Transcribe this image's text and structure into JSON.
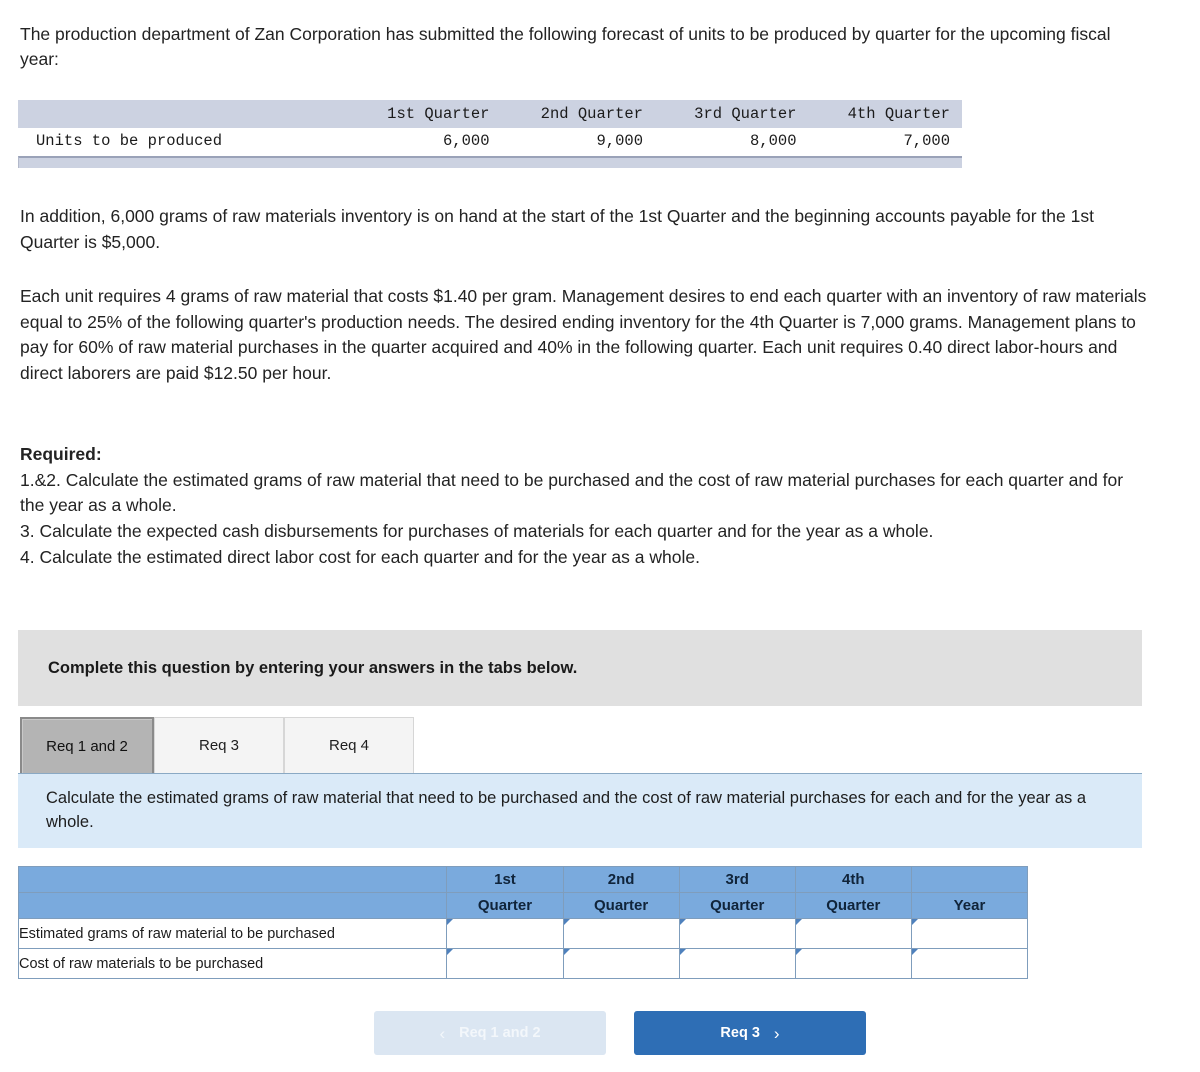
{
  "stem": {
    "text": "The production department of Zan Corporation has submitted the following forecast of units to be produced by quarter for the upcoming fiscal year:"
  },
  "given_table": {
    "headers": [
      "",
      "1st Quarter",
      "2nd Quarter",
      "3rd Quarter",
      "4th Quarter"
    ],
    "rows": [
      {
        "label": "Units to be produced",
        "values": [
          "6,000",
          "9,000",
          "8,000",
          "7,000"
        ]
      }
    ]
  },
  "paragraphs": {
    "in_addition": "In addition, 6,000 grams of raw materials inventory is on hand at the start of the 1st Quarter and the beginning accounts payable for the 1st Quarter is $5,000.",
    "each_unit": "Each unit requires 4 grams of raw material that costs $1.40 per gram. Management desires to end each quarter with an inventory of raw materials equal to 25% of the following quarter's production needs. The desired ending inventory for the 4th Quarter is 7,000 grams. Management plans to pay for 60% of raw material purchases in the quarter acquired and 40% in the following quarter. Each unit requires 0.40 direct labor-hours and direct laborers are paid $12.50 per hour."
  },
  "required": {
    "title": "Required:",
    "items": [
      "1.&2. Calculate the estimated grams of raw material that need to be purchased and the cost of raw material purchases for each quarter and for the year as a whole.",
      "3. Calculate the expected cash disbursements for purchases of materials for each quarter and for the year as a whole.",
      "4. Calculate the estimated direct labor cost for each quarter and for the year as a whole."
    ]
  },
  "complete_bar": {
    "text": "Complete this question by entering your answers in the tabs below."
  },
  "tabs": [
    {
      "label": "Req 1 and 2",
      "active": true
    },
    {
      "label": "Req 3",
      "active": false
    },
    {
      "label": "Req 4",
      "active": false
    }
  ],
  "req_panel": {
    "text": "Calculate the estimated grams of raw material that need to be purchased and the cost of raw material purchases for each and for the year as a whole."
  },
  "answer_table": {
    "header_row1": [
      "",
      "1st",
      "2nd",
      "3rd",
      "4th",
      ""
    ],
    "header_row2": [
      "",
      "Quarter",
      "Quarter",
      "Quarter",
      "Quarter",
      "Year"
    ],
    "rows": [
      {
        "label": "Estimated grams of raw material to be purchased",
        "cells": [
          "",
          "",
          "",
          "",
          ""
        ]
      },
      {
        "label": "Cost of raw materials to be purchased",
        "cells": [
          "",
          "",
          "",
          "",
          ""
        ]
      }
    ]
  },
  "nav": {
    "prev_label": "Req 1 and 2",
    "prev_icon": "chevron-left-icon",
    "prev_glyph": "‹",
    "next_label": "Req 3",
    "next_icon": "chevron-right-icon",
    "next_glyph": "›"
  },
  "colors": {
    "given_header": "#ccd2e1",
    "complete_bar": "#e0e0e0",
    "req_panel": "#daeaf8",
    "answer_header": "#7aaadd",
    "input_border": "#4f81bd",
    "next_button": "#2e6eb5",
    "prev_button": "#dbe6f2"
  }
}
